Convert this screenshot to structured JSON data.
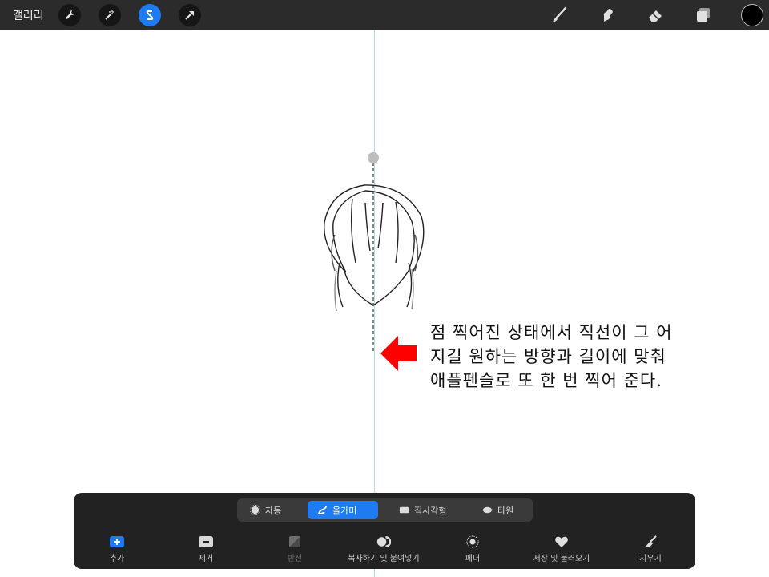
{
  "topbar": {
    "gallery_label": "갤러리",
    "left_tools": [
      "wrench-icon",
      "magic-wand-icon",
      "selection-icon",
      "transform-icon"
    ],
    "active_tool": "selection-icon",
    "right_tools": [
      "brush-icon",
      "smudge-icon",
      "eraser-icon",
      "layers-icon"
    ],
    "current_color": "#000000",
    "accent_color": "#1f7bf2"
  },
  "canvas": {
    "annotation": "점 찍어진 상태에서 직선이 그 어지길 원하는 방향과 길이에 맞춰 애플펜슬로 또 한 번 찍어 준다.",
    "guide_color": "#aee2e6",
    "arrow_color": "#ff0000"
  },
  "selection_panel": {
    "modes": [
      {
        "label": "자동",
        "icon": "sparkle-icon",
        "active": false
      },
      {
        "label": "올가미",
        "icon": "lasso-icon",
        "active": true
      },
      {
        "label": "직사각형",
        "icon": "rectangle-icon",
        "active": false
      },
      {
        "label": "타원",
        "icon": "ellipse-icon",
        "active": false
      }
    ],
    "actions": [
      {
        "label": "추가",
        "icon": "plus-icon",
        "enabled": true
      },
      {
        "label": "제거",
        "icon": "minus-icon",
        "enabled": true
      },
      {
        "label": "반전",
        "icon": "invert-icon",
        "enabled": false
      },
      {
        "label": "복사하기 및 붙여넣기",
        "icon": "copy-paste-icon",
        "enabled": true
      },
      {
        "label": "페더",
        "icon": "feather-icon",
        "enabled": true
      },
      {
        "label": "저장 및 불러오기",
        "icon": "heart-icon",
        "enabled": true
      },
      {
        "label": "지우기",
        "icon": "clear-icon",
        "enabled": true
      }
    ]
  }
}
